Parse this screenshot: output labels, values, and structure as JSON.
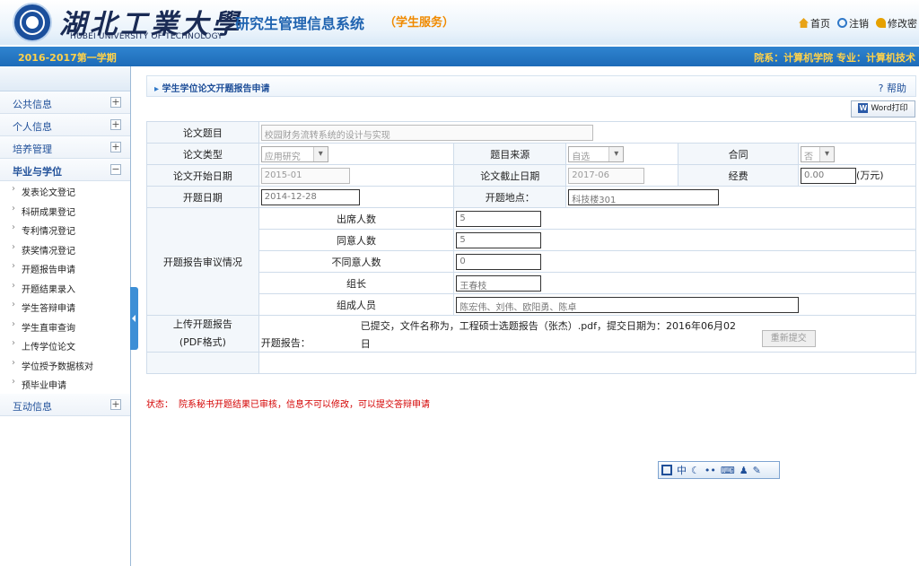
{
  "header": {
    "university_cn": "湖北工業大學",
    "university_en": "HUBEI UNIVERSITY OF TECHNOLOGY",
    "system_title": "研究生管理信息系统",
    "system_sub": "（学生服务）",
    "links": {
      "home": "首页",
      "logout": "注销",
      "change_pwd": "修改密"
    }
  },
  "bar": {
    "term": "2016-2017第一学期",
    "dept": "院系：计算机学院   专业：计算机技术"
  },
  "sidebar": {
    "groups": [
      {
        "label": "公共信息",
        "toggle": "+"
      },
      {
        "label": "个人信息",
        "toggle": "+"
      },
      {
        "label": "培养管理",
        "toggle": "+"
      },
      {
        "label": "毕业与学位",
        "toggle": "−"
      }
    ],
    "items": [
      "发表论文登记",
      "科研成果登记",
      "专利情况登记",
      "获奖情况登记",
      "开题报告申请",
      "开题结果录入",
      "学生答辩申请",
      "学生直审查询",
      "上传学位论文",
      "学位授予数据核对",
      "预毕业申请"
    ],
    "last_group": {
      "label": "互动信息",
      "toggle": "+"
    }
  },
  "page": {
    "title": "学生学位论文开题报告申请",
    "help": "帮助",
    "word_print": "Word打印"
  },
  "form": {
    "thesis_title_label": "论文题目",
    "thesis_title_value": "校园财务流转系统的设计与实现",
    "thesis_type_label": "论文类型",
    "thesis_type_value": "应用研究",
    "source_label": "题目来源",
    "source_value": "自选",
    "contract_label": "合同",
    "contract_value": "否",
    "start_date_label": "论文开始日期",
    "start_date_value": "2015-01",
    "end_date_label": "论文截止日期",
    "end_date_value": "2017-06",
    "fund_label": "经费",
    "fund_value": "0.00",
    "fund_unit": "(万元)",
    "open_date_label": "开题日期",
    "open_date_value": "2014-12-28",
    "open_place_label": "开题地点：",
    "open_place_value": "科技楼301",
    "review_label": "开题报告审议情况",
    "attend_label": "出席人数",
    "attend_value": "5",
    "agree_label": "同意人数",
    "agree_value": "5",
    "disagree_label": "不同意人数",
    "disagree_value": "0",
    "leader_label": "组长",
    "leader_value": "王春枝",
    "members_label": "组成人员",
    "members_value": "陈宏伟、刘伟、欧阳勇、陈卓",
    "upload_label_1": "上传开题报告",
    "upload_label_2": "(PDF格式)",
    "report_label": "开题报告：",
    "report_info_1": "已提交，文件名称为，工程硕士选题报告（张杰）.pdf，提交日期为：2016年06月02",
    "report_info_2": "日",
    "resubmit_label": "重新提交"
  },
  "status": {
    "label": "状态：",
    "text": "院系秘书开题结果已审核，信息不可以修改，可以提交答辩申请"
  },
  "ime": {
    "text": "中"
  },
  "colors": {
    "brand": "#1f63b0",
    "accent": "#f08a00",
    "bar": "#1d6bb8",
    "status": "#d40000"
  }
}
